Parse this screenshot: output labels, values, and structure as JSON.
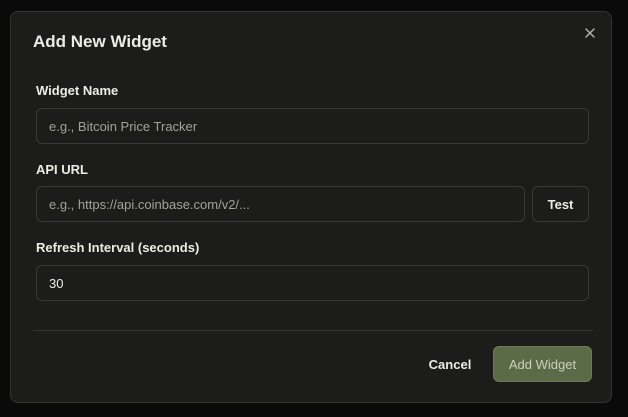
{
  "dialog": {
    "title": "Add New Widget",
    "close_icon": "close-icon"
  },
  "fields": {
    "widget_name": {
      "label": "Widget Name",
      "placeholder": "e.g., Bitcoin Price Tracker",
      "value": ""
    },
    "api_url": {
      "label": "API URL",
      "placeholder": "e.g., https://api.coinbase.com/v2/...",
      "value": "",
      "test_label": "Test"
    },
    "refresh_interval": {
      "label": "Refresh Interval (seconds)",
      "value": "30"
    }
  },
  "footer": {
    "cancel_label": "Cancel",
    "submit_label": "Add Widget"
  },
  "colors": {
    "background": "#1c1d1a",
    "primary_button": "#5b6b47",
    "text": "#ecebe4"
  }
}
